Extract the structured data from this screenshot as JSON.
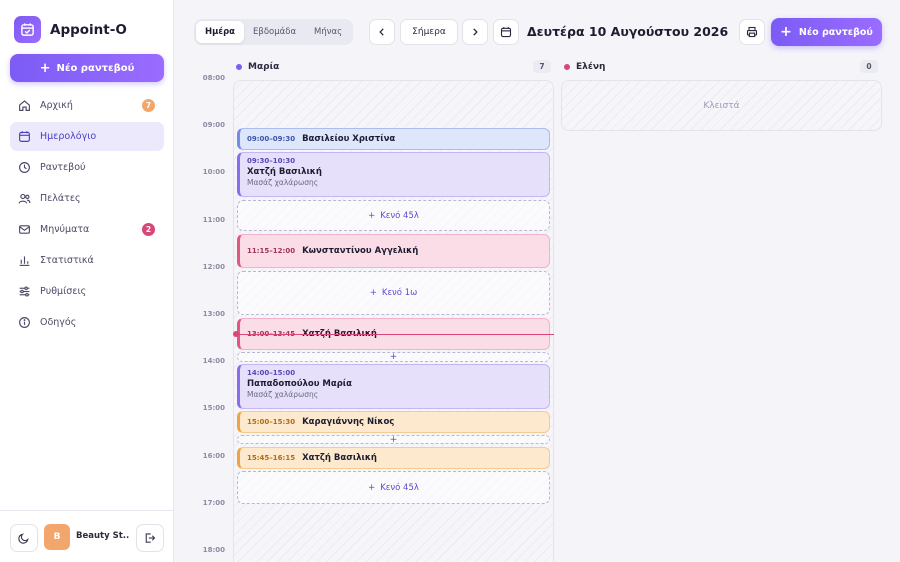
{
  "app": {
    "name": "Appoint-O",
    "logo_icon": "calendar-check-icon"
  },
  "sidebar": {
    "new_button": "Νέο ραντεβού",
    "items": [
      {
        "label": "Αρχική",
        "icon": "home-icon",
        "badge": "7",
        "badge_color": "#f2a66c"
      },
      {
        "label": "Ημερολόγιο",
        "icon": "calendar-icon",
        "active": true
      },
      {
        "label": "Ραντεβού",
        "icon": "clock-icon"
      },
      {
        "label": "Πελάτες",
        "icon": "users-icon"
      },
      {
        "label": "Μηνύματα",
        "icon": "mail-icon",
        "badge": "2",
        "badge_color": "#d9467a"
      },
      {
        "label": "Στατιστικά",
        "icon": "bar-chart-icon"
      },
      {
        "label": "Ρυθμίσεις",
        "icon": "sliders-icon"
      },
      {
        "label": "Οδηγός",
        "icon": "info-icon"
      }
    ],
    "footer": {
      "avatar_initial": "B",
      "user_name": "Beauty Studio",
      "user_display": "Beauty St..."
    }
  },
  "toolbar": {
    "views": [
      "Ημέρα",
      "Εβδομάδα",
      "Μήνας"
    ],
    "active_view": "Ημέρα",
    "today_label": "Σήμερα",
    "date_title": "Δευτέρα 10 Αυγούστου 2026",
    "new_button": "Νέο ραντεβού"
  },
  "hours": [
    "08:00",
    "09:00",
    "10:00",
    "11:00",
    "12:00",
    "13:00",
    "14:00",
    "15:00",
    "16:00",
    "17:00",
    "18:00"
  ],
  "staff": [
    {
      "name": "Μαρία",
      "count": "7",
      "color": "#7c5cf5"
    },
    {
      "name": "Ελένη",
      "count": "0",
      "color": "#d9467a",
      "closed_label": "Κλειστά"
    }
  ],
  "appointments": [
    {
      "time": "09:00–09:30",
      "client": "Βασιλείου Χριστίνα",
      "service": "",
      "color": "blue"
    },
    {
      "time": "09:30–10:30",
      "client": "Χατζή Βασιλική",
      "service": "Μασάζ χαλάρωσης",
      "color": "purple"
    },
    {
      "time": "11:15–12:00",
      "client": "Κωνσταντίνου Αγγελική",
      "service": "",
      "color": "pink"
    },
    {
      "time": "13:00–13:45",
      "client": "Χατζή Βασιλική",
      "service": "",
      "color": "pink"
    },
    {
      "time": "14:00–15:00",
      "client": "Παπαδοπούλου Μαρία",
      "service": "Μασάζ χαλάρωσης",
      "color": "purple"
    },
    {
      "time": "15:00–15:30",
      "client": "Καραγιάννης Νίκος",
      "service": "",
      "color": "orange"
    },
    {
      "time": "15:45–16:15",
      "client": "Χατζή Βασιλική",
      "service": "",
      "color": "orange"
    }
  ],
  "gaps": [
    "Κενό 45λ",
    "Κενό 1ω",
    "Κενό 45λ"
  ]
}
